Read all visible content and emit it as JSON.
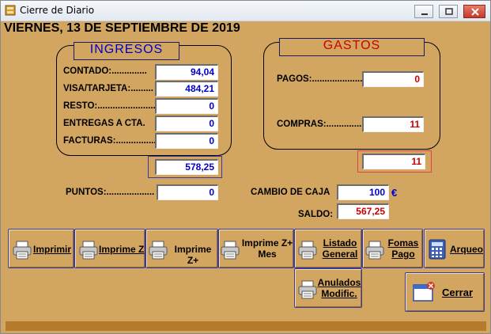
{
  "window": {
    "title": "Cierre de Diario"
  },
  "header": {
    "date": "VIERNES, 13 DE SEPTIEMBRE DE 2019"
  },
  "ingresos": {
    "title": "INGRESOS",
    "rows": [
      {
        "label": "CONTADO:..............",
        "value": "94,04"
      },
      {
        "label": "VISA/TARJETA:.........",
        "value": "484,21"
      },
      {
        "label": "RESTO:........................",
        "value": "0"
      },
      {
        "label": "ENTREGAS A CTA.",
        "value": "0"
      },
      {
        "label": "FACTURAS:................",
        "value": "0"
      }
    ],
    "total": "578,25"
  },
  "gastos": {
    "title": "GASTOS",
    "pagos_label": "PAGOS:...........................",
    "pagos_value": "0",
    "compras_label": "COMPRAS:......................",
    "compras_value": "11",
    "total": "11"
  },
  "puntos": {
    "label": "PUNTOS:...................",
    "value": "0"
  },
  "cambio": {
    "label": "CAMBIO DE CAJA",
    "value": "100",
    "currency": "€"
  },
  "saldo": {
    "label": "SALDO:",
    "value": "567,25"
  },
  "buttons": {
    "imprimir": "Imprimir",
    "imprime_z": "Imprime Z",
    "imprime_z_plus": "Imprime Z+",
    "imprime_z_mes": "Imprime Z+\nMes",
    "listado_general": "Listado\nGeneral",
    "fomas_pago": "Fomas\nPago",
    "arqueo": "Arqueo",
    "anulados": "Anulados\nModific.",
    "cerrar": "Cerrar"
  },
  "colors": {
    "background": "#d2a661",
    "value_blue": "#0000cc",
    "value_red": "#cc0000",
    "accent_border": "#3a3aa0"
  }
}
